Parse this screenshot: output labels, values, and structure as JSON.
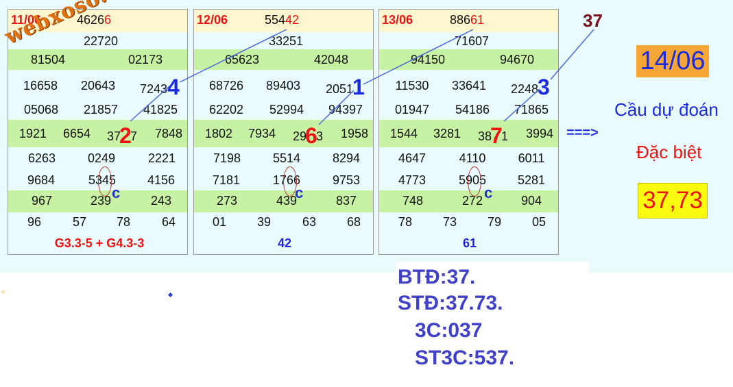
{
  "panels": [
    {
      "date": "11/06",
      "top_prefix": "4626",
      "top_suffix": "6",
      "rows": [
        [
          "22720"
        ],
        [
          "81504",
          "02173"
        ],
        [
          "16658",
          "20643",
          "7243"
        ],
        [
          "05068",
          "21857",
          "41825"
        ],
        [
          "1921",
          "6654",
          "37",
          "7",
          "7848"
        ],
        [
          "6263",
          "0249",
          "2221"
        ],
        [
          "9684",
          "5345",
          "4156"
        ],
        [
          "967",
          "239",
          "243"
        ],
        [
          "96",
          "57",
          "78",
          "64"
        ]
      ],
      "footer": "G3.3-5 + G4.3-3",
      "big_top": "4",
      "big_mid": "2",
      "c_mark": "c"
    },
    {
      "date": "12/06",
      "top_prefix": "554",
      "top_suffix": "42",
      "rows": [
        [
          "33251"
        ],
        [
          "65623",
          "42048"
        ],
        [
          "68726",
          "89403",
          "2051"
        ],
        [
          "62202",
          "52994",
          "94397"
        ],
        [
          "1802",
          "7934",
          "29",
          "3",
          "1958"
        ],
        [
          "7198",
          "5514",
          "8294"
        ],
        [
          "7181",
          "1766",
          "9753"
        ],
        [
          "273",
          "439",
          "837"
        ],
        [
          "01",
          "39",
          "63",
          "68"
        ]
      ],
      "footer": "42",
      "big_top": "1",
      "big_mid": "6",
      "c_mark": "c"
    },
    {
      "date": "13/06",
      "top_prefix": "886",
      "top_suffix": "61",
      "rows": [
        [
          "71607"
        ],
        [
          "94150",
          "94670"
        ],
        [
          "11530",
          "33641",
          "2248"
        ],
        [
          "01947",
          "54186",
          "71865"
        ],
        [
          "1544",
          "3281",
          "38",
          "1",
          "3994"
        ],
        [
          "4647",
          "4110",
          "6011"
        ],
        [
          "4773",
          "5905",
          "5281"
        ],
        [
          "748",
          "272",
          "904"
        ],
        [
          "78",
          "73",
          "79",
          "05"
        ]
      ],
      "footer": "61",
      "big_top": "3",
      "big_mid": "7",
      "c_mark": "c"
    }
  ],
  "watermark": "webxoso.net",
  "top_label": "37",
  "arrow": "===>",
  "predict_date": "14/06",
  "predict_title": "Cầu dự đoán",
  "predict_type": "Đặc biệt",
  "predict_result": "37,73",
  "notes": [
    "BTĐ:37.",
    "STĐ:37.73.",
    "3C:037",
    "ST3C:537."
  ],
  "colors": {
    "red": "#ee1111",
    "blue": "#1a2adf",
    "green_row": "#c8f2a3",
    "header_row": "#fdf6cf",
    "orange": "#f5a637",
    "yellow": "#fafa10"
  }
}
